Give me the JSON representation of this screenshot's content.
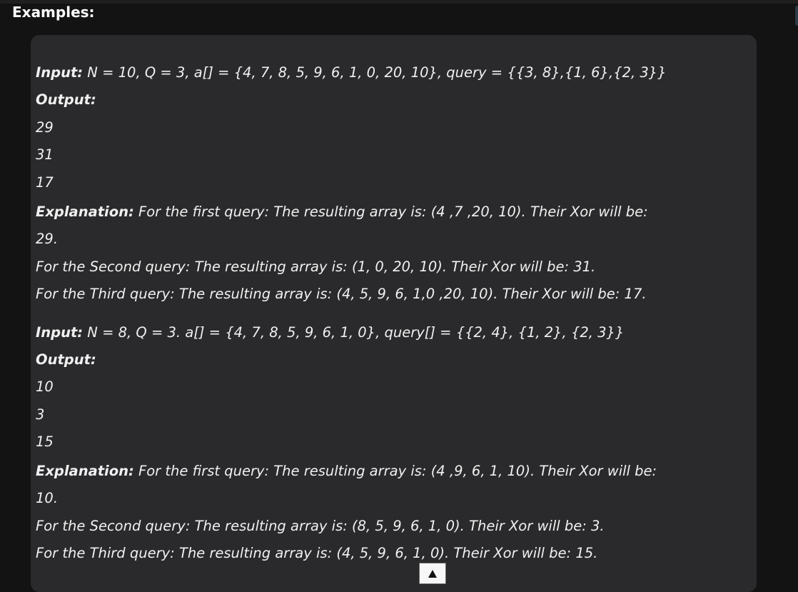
{
  "heading": "Examples:",
  "examples": [
    {
      "input_label": "Input:",
      "input_text": " N = 10, Q = 3, a[] = {4, 7, 8, 5, 9, 6, 1, 0, 20, 10}, query = {{3, 8},{1, 6},{2, 3}}",
      "output_label": "Output:",
      "outputs": [
        "29",
        "31",
        "17"
      ],
      "explanation_label": "Explanation:",
      "explanation_lines": [
        " For the first query: The resulting array is: (4 ,7 ,20, 10). Their Xor will be:",
        "29.",
        "For the Second query: The resulting array is: (1, 0, 20, 10). Their Xor will be: 31.",
        "For the Third query: The resulting array is: (4, 5, 9, 6, 1,0 ,20, 10). Their Xor will be: 17."
      ]
    },
    {
      "input_label": "Input:",
      "input_text": " N = 8, Q = 3. a[] = {4, 7, 8, 5, 9, 6, 1, 0}, query[] = {{2, 4}, {1, 2}, {2, 3}}",
      "output_label": "Output:",
      "outputs": [
        "10",
        "3",
        "15"
      ],
      "explanation_label": "Explanation:",
      "explanation_lines": [
        " For the first query: The resulting array is: (4 ,9, 6, 1, 10). Their Xor will be:",
        "10.",
        "For the Second query: The resulting array is: (8, 5, 9, 6, 1, 0). Their Xor will be: 3.",
        "For the Third query: The resulting array is: (4, 5, 9, 6, 1, 0). Their Xor will be: 15."
      ]
    }
  ],
  "scroll_top_icon": "chevron-up-icon",
  "colors": {
    "page_bg": "#131313",
    "card_bg": "#2a2a2c",
    "text": "#f0f0f0",
    "heading": "#ffffff"
  }
}
